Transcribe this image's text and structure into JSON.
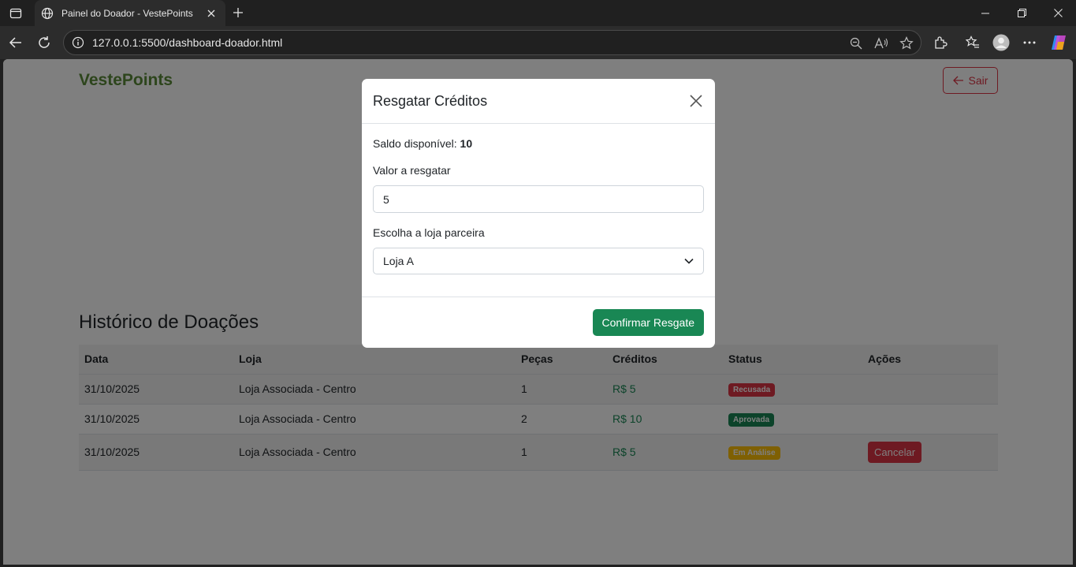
{
  "browser": {
    "tab_title": "Painel do Doador - VestePoints",
    "url": "127.0.0.1:5500/dashboard-doador.html"
  },
  "header": {
    "logo": "VestePoints",
    "logout_label": "Sair"
  },
  "history": {
    "title": "Histórico de Doações",
    "columns": [
      "Data",
      "Loja",
      "Peças",
      "Créditos",
      "Status",
      "Ações"
    ],
    "rows": [
      {
        "date": "31/10/2025",
        "store": "Loja Associada - Centro",
        "pieces": "1",
        "credits": "R$ 5",
        "status": "Recusada",
        "status_color": "#dc3545",
        "action": ""
      },
      {
        "date": "31/10/2025",
        "store": "Loja Associada - Centro",
        "pieces": "2",
        "credits": "R$ 10",
        "status": "Aprovada",
        "status_color": "#198754",
        "action": ""
      },
      {
        "date": "31/10/2025",
        "store": "Loja Associada - Centro",
        "pieces": "1",
        "credits": "R$ 5",
        "status": "Em Análise",
        "status_color": "#ffc107",
        "action": "Cancelar"
      }
    ]
  },
  "modal": {
    "title": "Resgatar Créditos",
    "balance_label": "Saldo disponível:",
    "balance_value": "10",
    "amount_label": "Valor a resgatar",
    "amount_value": "5",
    "store_label": "Escolha a loja parceira",
    "store_selected": "Loja A",
    "confirm_label": "Confirmar Resgate"
  },
  "colors": {
    "brand": "#5a8a38",
    "success": "#198754",
    "danger": "#dc3545",
    "warning": "#ffc107"
  }
}
